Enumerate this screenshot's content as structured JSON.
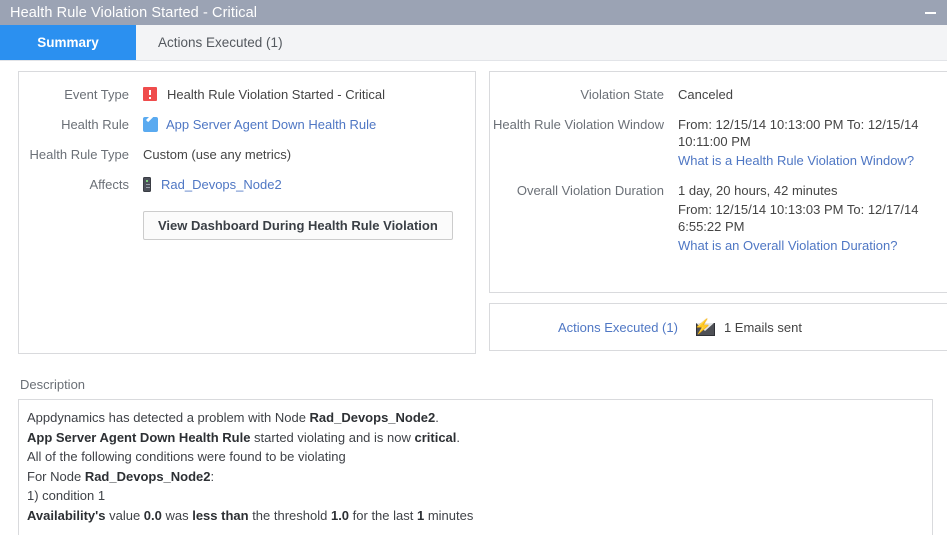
{
  "window": {
    "title": "Health Rule Violation Started - Critical",
    "minimize_label": "Minimize",
    "titlebar_color": "#9ba3b4"
  },
  "tabs": [
    {
      "label": "Summary",
      "active": true
    },
    {
      "label": "Actions Executed (1)",
      "active": false
    }
  ],
  "left_panel": {
    "fields": [
      {
        "label": "Event Type",
        "icon": "alert-icon",
        "value": "Health Rule Violation Started - Critical"
      },
      {
        "label": "Health Rule",
        "icon": "pencil-icon",
        "value": "App Server Agent Down Health Rule",
        "is_link": true
      },
      {
        "label": "Health Rule Type",
        "icon": null,
        "value": "Custom (use any metrics)"
      },
      {
        "label": "Affects",
        "icon": "node-icon",
        "value": "Rad_Devops_Node2",
        "is_link": true
      }
    ],
    "button_label": "View Dashboard During Health Rule Violation"
  },
  "right_panel": {
    "violation_state_label": "Violation State",
    "violation_state_value": "Canceled",
    "window_label": "Health Rule Violation Window",
    "window_value": "From: 12/15/14 10:13:00 PM To: 12/15/14 10:11:00 PM",
    "window_link": "What is a Health Rule Violation Window?",
    "duration_label": "Overall Violation Duration",
    "duration_value": "1 day, 20 hours, 42 minutes",
    "duration_range": "From: 12/15/14 10:13:03 PM To: 12/17/14 6:55:22 PM",
    "duration_link": "What is an Overall Violation Duration?",
    "actions_link": "Actions Executed (1)",
    "actions_icon": "email-bolt-icon",
    "actions_text": "1 Emails sent"
  },
  "description": {
    "title": "Description",
    "lines": [
      [
        {
          "t": "Appdynamics has detected a problem with Node ",
          "b": false
        },
        {
          "t": "Rad_Devops_Node2",
          "b": true
        },
        {
          "t": ".",
          "b": false
        }
      ],
      [
        {
          "t": "App Server Agent Down Health Rule",
          "b": true
        },
        {
          "t": " started violating and is now ",
          "b": false
        },
        {
          "t": "critical",
          "b": true
        },
        {
          "t": ".",
          "b": false
        }
      ],
      [
        {
          "t": "All of the following conditions were found to be violating",
          "b": false
        }
      ],
      [
        {
          "t": "For Node ",
          "b": false
        },
        {
          "t": "Rad_Devops_Node2",
          "b": true
        },
        {
          "t": ":",
          "b": false
        }
      ],
      [
        {
          "t": "1) condition 1",
          "b": false
        }
      ],
      [
        {
          "t": "Availability's",
          "b": true
        },
        {
          "t": " value ",
          "b": false
        },
        {
          "t": "0.0",
          "b": true
        },
        {
          "t": " was ",
          "b": false
        },
        {
          "t": "less than",
          "b": true
        },
        {
          "t": " the threshold ",
          "b": false
        },
        {
          "t": " 1.0",
          "b": true
        },
        {
          "t": " for the last ",
          "b": false
        },
        {
          "t": "1",
          "b": true
        },
        {
          "t": " minutes",
          "b": false
        }
      ]
    ]
  },
  "colors": {
    "accent_blue": "#2b90f0",
    "link_blue": "#4f77c4",
    "alert_red": "#ef4c4c",
    "bolt_orange": "#f5a623"
  }
}
